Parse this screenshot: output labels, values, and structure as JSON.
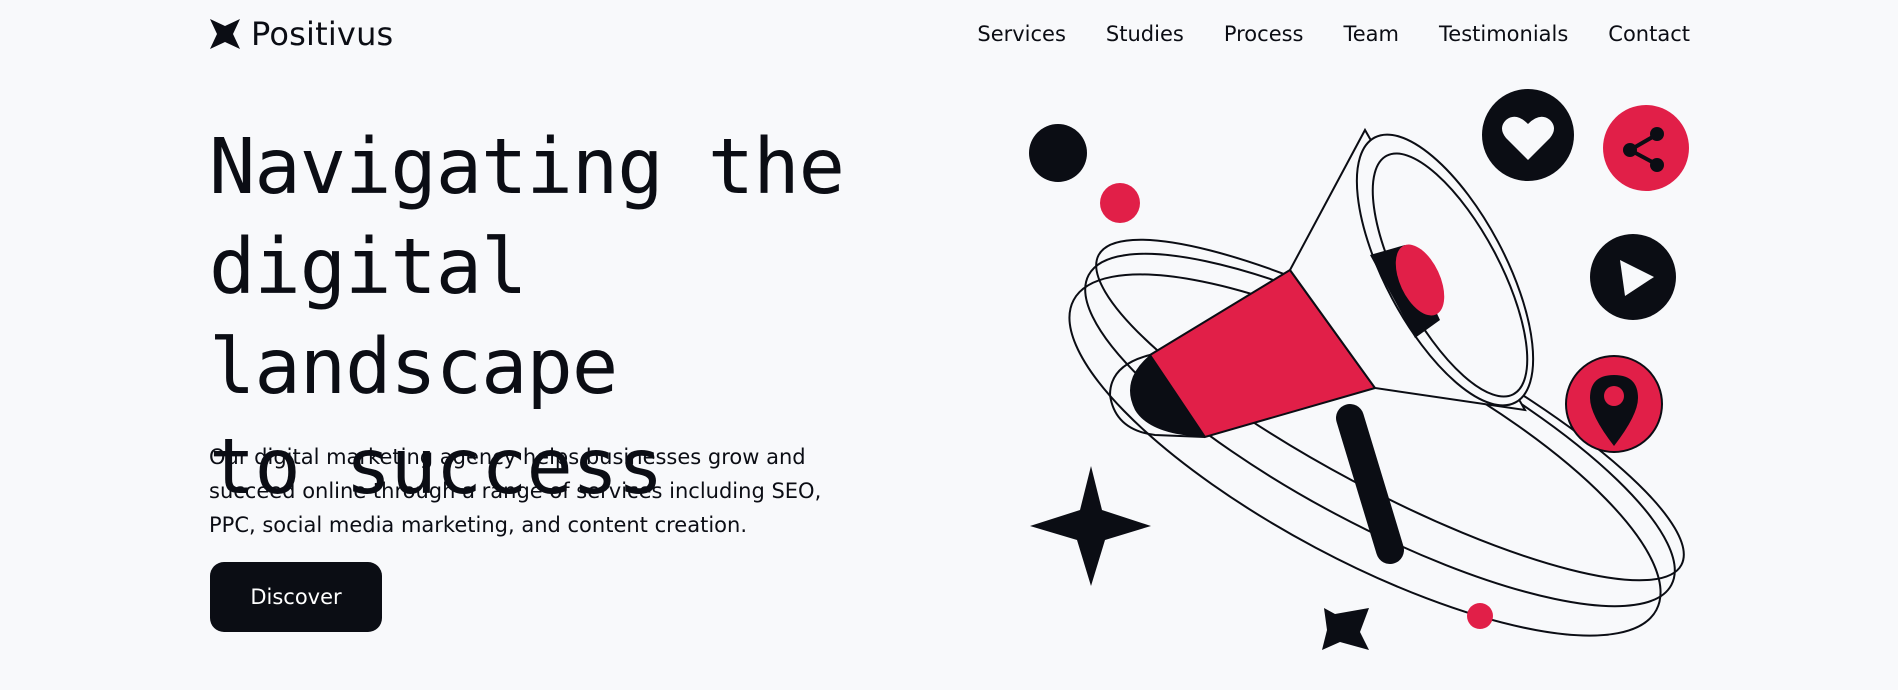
{
  "brand": {
    "name": "Positivus",
    "icon": "star-logo-icon"
  },
  "nav": {
    "items": [
      "Services",
      "Studies",
      "Process",
      "Team",
      "Testimonials",
      "Contact"
    ]
  },
  "hero": {
    "title_lines": [
      "Navigating the",
      "digital landscape",
      "to success"
    ],
    "description_lines": [
      "Our digital marketing agency helps businesses grow and",
      "succeed online through a range of services including SEO,",
      "PPC, social media marketing, and content creation."
    ],
    "cta_label": "Discover"
  },
  "illustration": {
    "icons": [
      "megaphone-icon",
      "heart-icon",
      "share-icon",
      "play-icon",
      "location-pin-icon",
      "sparkle-star-icon"
    ]
  },
  "colors": {
    "accent": "#e11f48",
    "dark": "#0b0d14",
    "background": "#f8f9fb"
  }
}
